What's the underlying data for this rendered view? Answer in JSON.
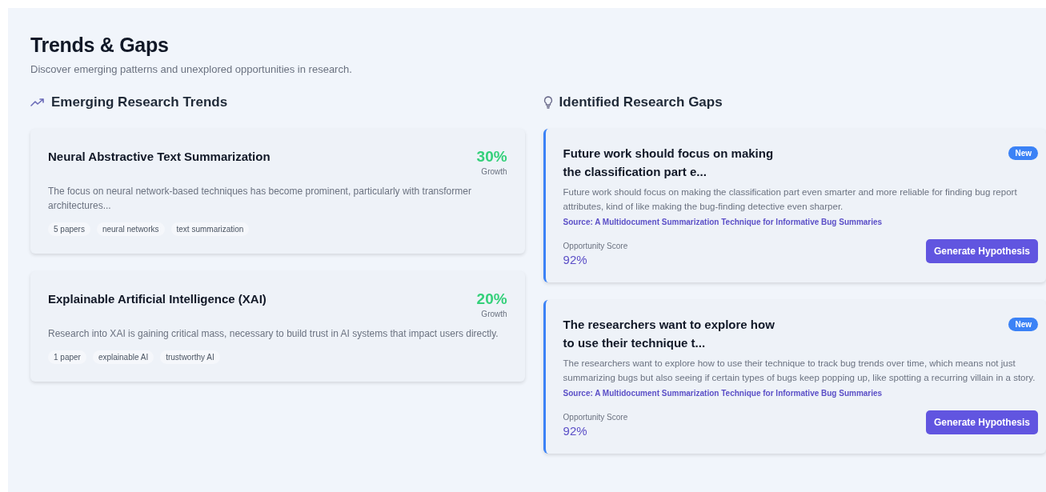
{
  "page": {
    "title": "Trends & Gaps",
    "subtitle": "Discover emerging patterns and unexplored opportunities in research."
  },
  "trends": {
    "heading": "Emerging Research Trends",
    "items": [
      {
        "title": "Neural Abstractive Text Summarization",
        "growth": "30%",
        "growth_label": "Growth",
        "description": "The focus on neural network-based techniques has become prominent, particularly with transformer architectures...",
        "tags": [
          "5 papers",
          "neural networks",
          "text summarization"
        ]
      },
      {
        "title": "Explainable Artificial Intelligence (XAI)",
        "growth": "20%",
        "growth_label": "Growth",
        "description": "Research into XAI is gaining critical mass, necessary to build trust in AI systems that impact users directly.",
        "tags": [
          "1 paper",
          "explainable AI",
          "trustworthy AI"
        ]
      }
    ]
  },
  "gaps": {
    "heading": "Identified Research Gaps",
    "items": [
      {
        "title_lines": [
          "Future work should focus on making",
          "the classification part e..."
        ],
        "badge": "New",
        "description": "Future work should focus on making the classification part even smarter and more reliable for finding bug report attributes, kind of like making the bug-finding detective even sharper.",
        "source": "Source: A Multidocument Summarization Technique for Informative Bug Summaries",
        "score_label": "Opportunity Score",
        "score": "92%",
        "button": "Generate Hypothesis"
      },
      {
        "title_lines": [
          "The researchers want to explore how",
          "to use their technique t..."
        ],
        "badge": "New",
        "description": "The researchers want to explore how to use their technique to track bug trends over time, which means not just summarizing bugs but also seeing if certain types of bugs keep popping up, like spotting a recurring villain in a story.",
        "source": "Source: A Multidocument Summarization Technique for Informative Bug Summaries",
        "score_label": "Opportunity Score",
        "score": "92%",
        "button": "Generate Hypothesis"
      }
    ]
  }
}
